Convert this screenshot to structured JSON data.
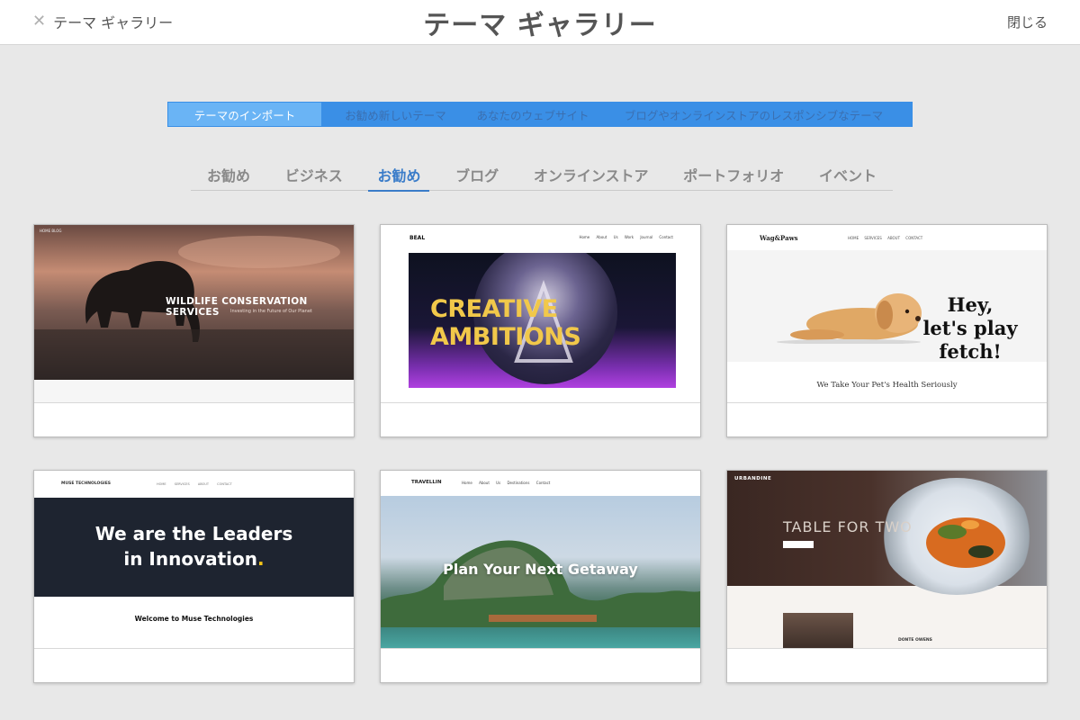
{
  "header": {
    "back_label": "テーマ ギャラリー",
    "title": "テーマ ギャラリー",
    "close_label": "閉じる"
  },
  "segment_tabs": {
    "items": [
      {
        "label": "テーマのインポート",
        "active": true
      },
      {
        "label": "お勧め新しいテーマ",
        "active": false
      },
      {
        "label": "あなたのウェブサイト",
        "active": false
      },
      {
        "label": "ブログやオンラインストアのレスポンシブなテーマ",
        "active": false
      }
    ],
    "active_color": "#6ab4f5",
    "bar_color": "#3a8fe6"
  },
  "categories": {
    "items": [
      {
        "label": "お勧め",
        "active": false
      },
      {
        "label": "ビジネス",
        "active": false
      },
      {
        "label": "お勧め",
        "active": true
      },
      {
        "label": "ブログ",
        "active": false
      },
      {
        "label": "オンラインストア",
        "active": false
      },
      {
        "label": "ポートフォリオ",
        "active": false
      },
      {
        "label": "イベント",
        "active": false
      }
    ],
    "active_color": "#3a7cc9"
  },
  "themes": [
    {
      "title": "WILDLIFE CONSERVATION SERVICES",
      "subtitle": "Investing in the Future of Our Planet",
      "nav": "HOME   BLOG"
    },
    {
      "logo": "BEAL",
      "nav": "Home   About Us   Work   Journal   Contact",
      "hero_text_line1": "CREATIVE",
      "hero_text_line2": "AMBITIONS"
    },
    {
      "logo": "Wag&Paws",
      "nav": "HOME SERVICES ABOUT CONTACT",
      "hero_line1": "Hey,",
      "hero_line2": "let's play",
      "hero_line3": "fetch!",
      "tagline": "We Take Your Pet's Health Seriously"
    },
    {
      "logo": "MUSE TECHNOLOGIES",
      "nav": "HOME SERVICES ABOUT CONTACT",
      "headline_line1": "We are the Leaders",
      "headline_line2": "in Innovation",
      "headline_dot": ".",
      "welcome": "Welcome to Muse Technologies"
    },
    {
      "logo": "TRAVELLIN",
      "nav": "Home   About Us   Destinations   Contact",
      "title": "Plan Your Next Getaway"
    },
    {
      "logo": "URBANDINE",
      "title": "TABLE FOR TWO",
      "label": "DONTE OWENS"
    }
  ]
}
